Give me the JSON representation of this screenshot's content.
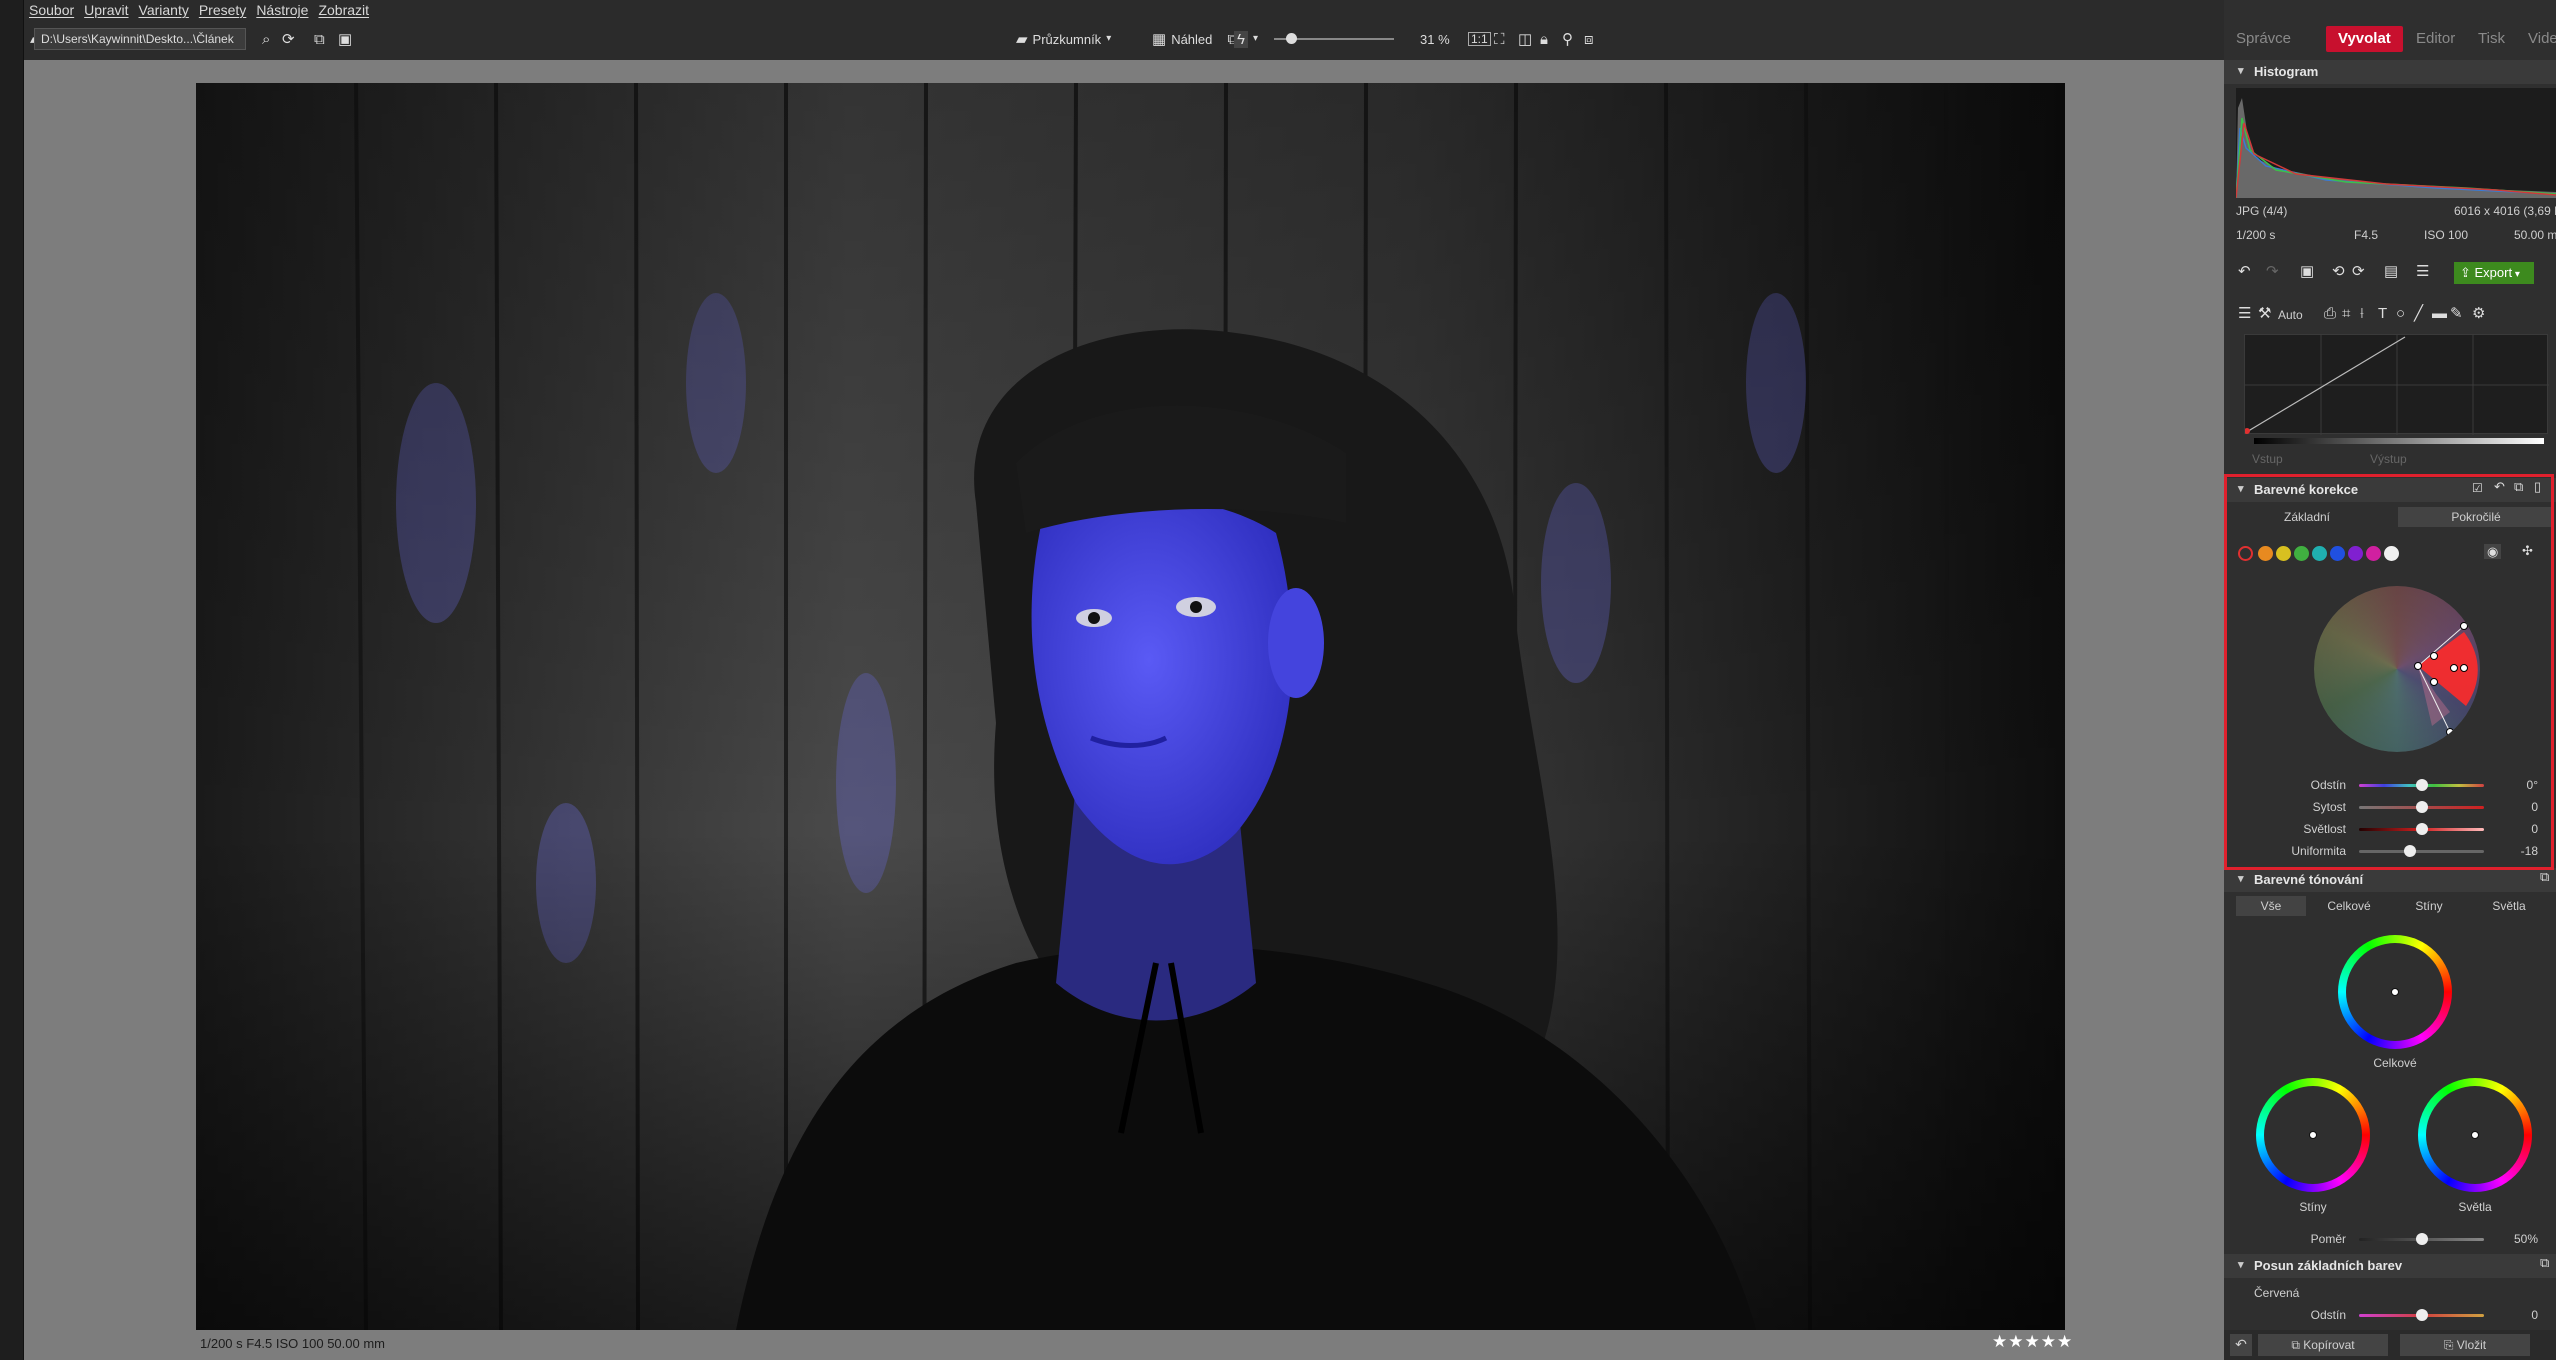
{
  "menu": [
    "Soubor",
    "Upravit",
    "Varianty",
    "Presety",
    "Nástroje",
    "Zobrazit"
  ],
  "toolbar": {
    "path": "D:\\Users\\Kaywinnit\\Deskto...\\Článek",
    "browser_label": "Průzkumník",
    "preview_label": "Náhled",
    "zoom_value": "31 %"
  },
  "tabs": {
    "manager": "Správce",
    "develop": "Vyvolat",
    "editor": "Editor",
    "print": "Tisk",
    "video": "Vide"
  },
  "histogram": {
    "title": "Histogram",
    "format": "JPG  (4/4)",
    "dimensions": "6016 x 4016 (3,69 M",
    "shutter": "1/200 s",
    "aperture": "F4.5",
    "iso": "ISO 100",
    "focal": "50.00 m"
  },
  "actions": {
    "export_label": "Export",
    "auto_label": "Auto"
  },
  "curves": {
    "input_label": "Vstup",
    "output_label": "Výstup"
  },
  "color_correction": {
    "title": "Barevné korekce",
    "tab_basic": "Základní",
    "tab_advanced": "Pokročilé",
    "swatch_colors": [
      "#e03030",
      "#e88a20",
      "#d8c020",
      "#40b040",
      "#20b0b0",
      "#2050e0",
      "#8020d0",
      "#d020a0",
      "#f0f0f0"
    ],
    "sliders": [
      {
        "label": "Odstín",
        "value": "0°",
        "level": 0.5
      },
      {
        "label": "Sytost",
        "value": "0",
        "level": 0.5
      },
      {
        "label": "Světlost",
        "value": "0",
        "level": 0.5
      },
      {
        "label": "Uniformita",
        "value": "-18",
        "level": 0.41
      }
    ]
  },
  "toning": {
    "title": "Barevné tónování",
    "tabs": [
      "Vše",
      "Celkové",
      "Stíny",
      "Světla"
    ],
    "overall_label": "Celkové",
    "shadows_label": "Stíny",
    "highlights_label": "Světla",
    "ratio_label": "Poměr",
    "ratio_value": "50%",
    "ratio_level": 0.5
  },
  "base_colors": {
    "title": "Posun základních barev",
    "channel": "Červená",
    "hue_label": "Odstín",
    "hue_value": "0"
  },
  "bottom": {
    "copy_label": "Kopírovat",
    "paste_label": "Vložit"
  },
  "statusbar": {
    "info": "1/200 s   F4.5   ISO 100   50.00 mm",
    "rating": "★★★★★"
  },
  "colors": {
    "accent": "#c8102e",
    "export_green": "#3d8a1e",
    "highlight_frame": "#e0202d",
    "mask_blue": "#4a4ae8"
  }
}
